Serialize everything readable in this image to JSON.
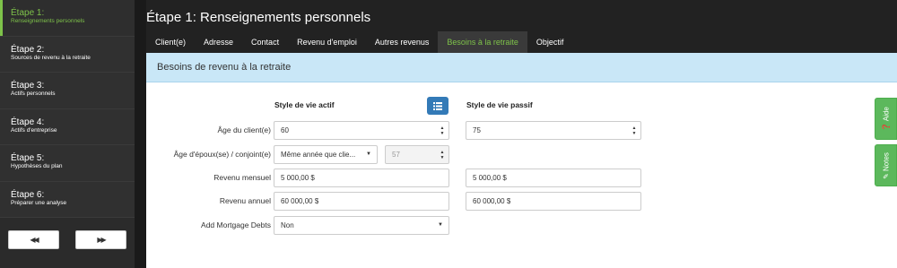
{
  "sidebar": {
    "steps": [
      {
        "title": "Étape 1:",
        "subtitle": "Renseignements personnels"
      },
      {
        "title": "Étape 2:",
        "subtitle": "Sources de revenu à la retraite"
      },
      {
        "title": "Étape 3:",
        "subtitle": "Actifs personnels"
      },
      {
        "title": "Étape 4:",
        "subtitle": "Actifs d'entreprise"
      },
      {
        "title": "Étape 5:",
        "subtitle": "Hypothèses du plan"
      },
      {
        "title": "Étape 6:",
        "subtitle": "Préparer une analyse"
      }
    ],
    "prev_label": "◀◀",
    "next_label": "▶▶"
  },
  "header": {
    "title": "Étape 1: Renseignements personnels",
    "tabs": [
      "Client(e)",
      "Adresse",
      "Contact",
      "Revenu d'emploi",
      "Autres revenus",
      "Besoins à la retraite",
      "Objectif"
    ]
  },
  "panel": {
    "title": "Besoins de revenu à la retraite",
    "col_active": "Style de vie actif",
    "col_passive": "Style de vie passif",
    "rows": {
      "age_client": {
        "label": "Âge du client(e)",
        "active": "60",
        "passive": "75"
      },
      "age_spouse": {
        "label": "Âge d'époux(se) / conjoint(e)",
        "select": "Même année que clie...",
        "value": "57"
      },
      "monthly": {
        "label": "Revenu mensuel",
        "active": "5 000,00 $",
        "passive": "5 000,00 $"
      },
      "annual": {
        "label": "Revenu annuel",
        "active": "60 000,00 $",
        "passive": "60 000,00 $"
      },
      "mortgage": {
        "label": "Add Mortgage Debts",
        "value": "Non"
      }
    }
  },
  "sidetabs": {
    "help": "❓ Aide",
    "notes": "✎ Notes"
  }
}
